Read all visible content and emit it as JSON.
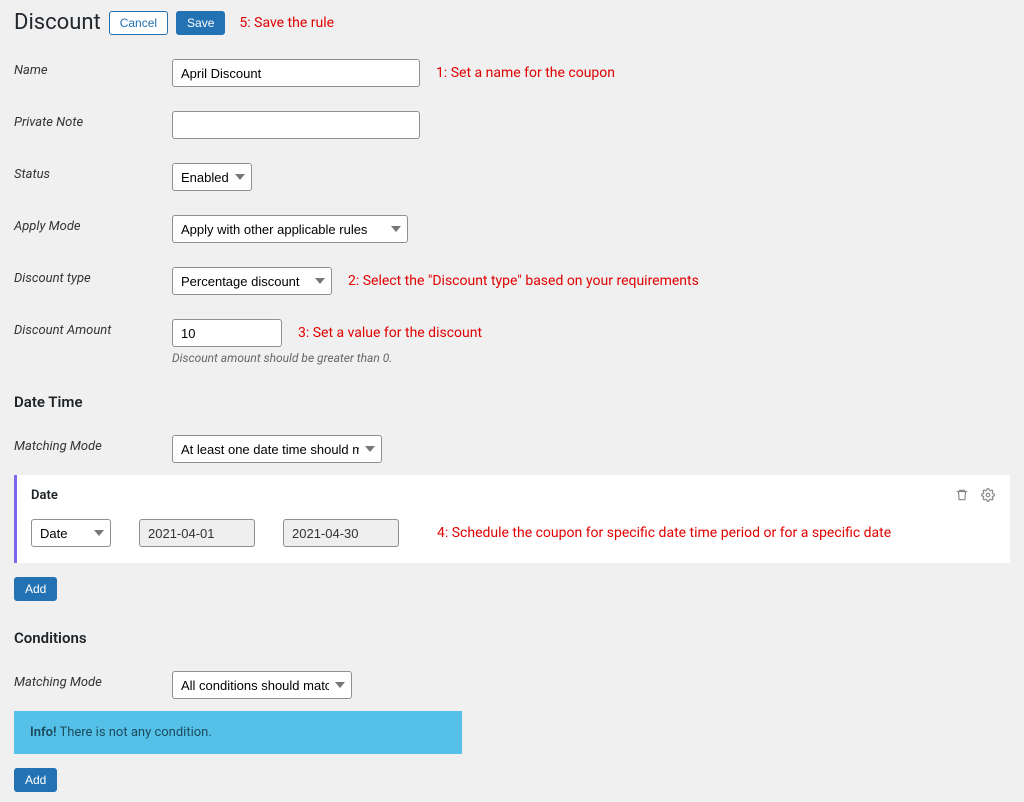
{
  "header": {
    "title": "Discount",
    "cancel": "Cancel",
    "save": "Save",
    "annotation": "5: Save the rule"
  },
  "fields": {
    "name": {
      "label": "Name",
      "value": "April Discount",
      "annotation": "1: Set a name for the coupon"
    },
    "private_note": {
      "label": "Private Note",
      "value": ""
    },
    "status": {
      "label": "Status",
      "value": "Enabled"
    },
    "apply_mode": {
      "label": "Apply Mode",
      "value": "Apply with other applicable rules"
    },
    "discount_type": {
      "label": "Discount type",
      "value": "Percentage discount",
      "annotation": "2: Select the \"Discount type\" based on your requirements"
    },
    "discount_amount": {
      "label": "Discount Amount",
      "value": "10",
      "annotation": "3: Set a value for the discount",
      "hint": "Discount amount should be greater than 0."
    }
  },
  "datetime": {
    "title": "Date Time",
    "matching_mode_label": "Matching Mode",
    "matching_mode_value": "At least one date time should match",
    "card_title": "Date",
    "type_select": "Date",
    "from": "2021-04-01",
    "to": "2021-04-30",
    "annotation": "4: Schedule the coupon for specific date time period or for a specific date",
    "add": "Add"
  },
  "conditions": {
    "title": "Conditions",
    "matching_mode_label": "Matching Mode",
    "matching_mode_value": "All conditions should match",
    "info_bold": "Info!",
    "info_text": " There is not any condition.",
    "add": "Add"
  }
}
